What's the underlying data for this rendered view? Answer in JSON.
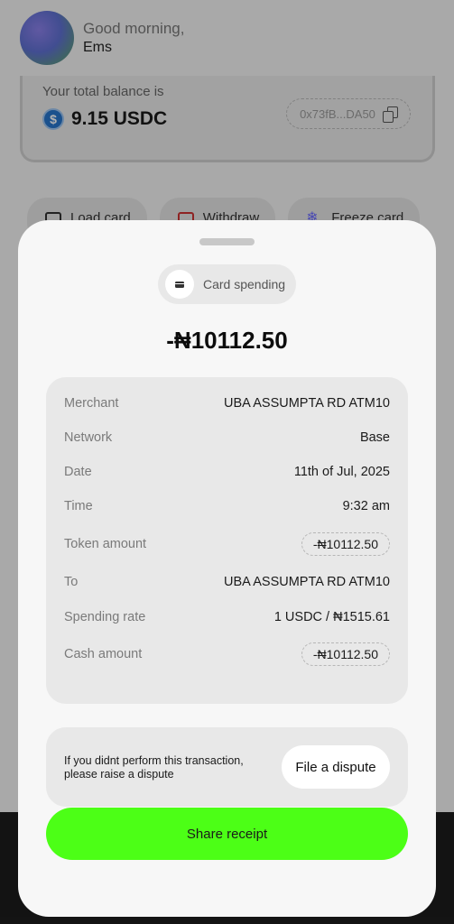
{
  "header": {
    "greeting": "Good morning,",
    "name": "Ems"
  },
  "balance": {
    "label": "Your total balance is",
    "currency_icon": "$",
    "amount": "9.15 USDC",
    "address": "0x73fB...DA50"
  },
  "actions": [
    {
      "label": "Load card",
      "icon": "card-icon"
    },
    {
      "label": "Withdraw",
      "icon": "withdraw-icon"
    },
    {
      "label": "Freeze card",
      "icon": "snowflake-icon"
    }
  ],
  "sheet": {
    "type_label": "Card spending",
    "amount": "-₦10112.50",
    "details": [
      {
        "label": "Merchant",
        "value": "UBA ASSUMPTA RD ATM10"
      },
      {
        "label": "Network",
        "value": "Base"
      },
      {
        "label": "Date",
        "value": "11th of Jul, 2025"
      },
      {
        "label": "Time",
        "value": "9:32 am"
      },
      {
        "label": "Token amount",
        "value": "-₦10112.50"
      },
      {
        "label": "To",
        "value": "UBA ASSUMPTA RD ATM10"
      },
      {
        "label": "Spending rate",
        "value": "1 USDC / ₦1515.61"
      },
      {
        "label": "Cash amount",
        "value": "-₦10112.50"
      }
    ],
    "dispute_text": "If you didnt perform this transaction, please raise a dispute",
    "dispute_button": "File a dispute",
    "share_button": "Share receipt"
  },
  "colors": {
    "accent": "#4cff16",
    "usdc": "#2775ca"
  }
}
